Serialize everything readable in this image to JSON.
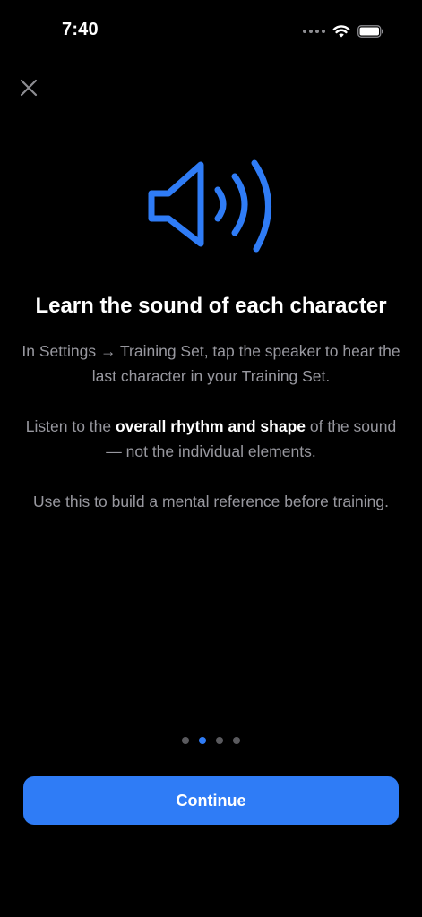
{
  "status_bar": {
    "time": "7:40",
    "icons": [
      "cellular-signal-icon",
      "wifi-icon",
      "battery-icon"
    ]
  },
  "close": {
    "icon": "close-icon"
  },
  "hero": {
    "icon": "speaker-sound-icon",
    "color": "#2f7cf6"
  },
  "onboarding": {
    "title": "Learn the sound of each character",
    "paragraph1": "In Settings → Training Set, tap the speaker to hear the last character in your Training Set.",
    "paragraph2_prefix": "Listen to the ",
    "paragraph2_emphasis": "overall rhythm and shape",
    "paragraph2_suffix": " of the sound — not the individual elements.",
    "paragraph3": "Use this to build a mental reference before training."
  },
  "pagination": {
    "pages": 4,
    "current_page": 2
  },
  "actions": {
    "continue_label": "Continue"
  },
  "colors": {
    "background": "#000000",
    "accent": "#2f7cf6",
    "secondary_text": "#98989f",
    "primary_text": "#ffffff"
  }
}
